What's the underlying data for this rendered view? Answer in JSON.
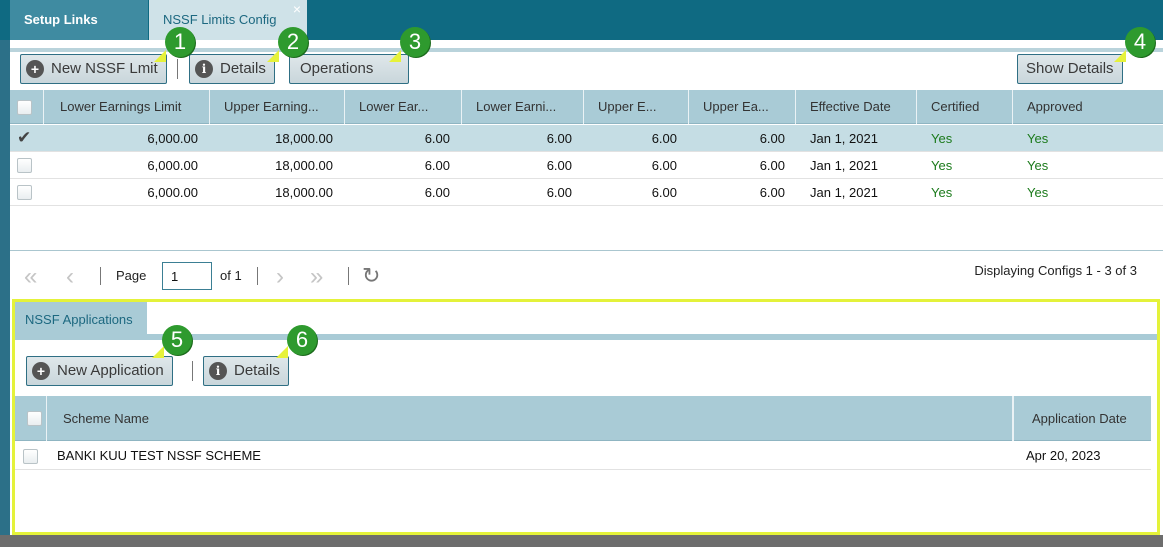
{
  "tabs": [
    {
      "label": "Setup Links"
    },
    {
      "label": "NSSF Limits Config",
      "close": "×"
    }
  ],
  "toolbar": {
    "new_label": "New NSSF Lmit",
    "details_label": "Details",
    "operations_label": "Operations",
    "show_details_label": "Show Details"
  },
  "grid": {
    "columns": [
      "Lower Earnings Limit",
      "Upper Earning...",
      "Lower Ear...",
      "Lower Earni...",
      "Upper E...",
      "Upper Ea...",
      "Effective Date",
      "Certified",
      "Approved"
    ],
    "rows": [
      {
        "selected": true,
        "cells": [
          "6,000.00",
          "18,000.00",
          "6.00",
          "6.00",
          "6.00",
          "6.00",
          "Jan 1, 2021",
          "Yes",
          "Yes"
        ]
      },
      {
        "selected": false,
        "cells": [
          "6,000.00",
          "18,000.00",
          "6.00",
          "6.00",
          "6.00",
          "6.00",
          "Jan 1, 2021",
          "Yes",
          "Yes"
        ]
      },
      {
        "selected": false,
        "cells": [
          "6,000.00",
          "18,000.00",
          "6.00",
          "6.00",
          "6.00",
          "6.00",
          "Jan 1, 2021",
          "Yes",
          "Yes"
        ]
      }
    ]
  },
  "pager": {
    "page_label": "Page",
    "page_value": "1",
    "of_label": "of 1",
    "display": "Displaying Configs 1 - 3 of 3"
  },
  "applications": {
    "tab_label": "NSSF Applications",
    "new_label": "New Application",
    "details_label": "Details",
    "columns": [
      "Scheme Name",
      "Application Date"
    ],
    "rows": [
      {
        "scheme": "BANKI KUU TEST NSSF SCHEME",
        "date": "Apr 20, 2023"
      }
    ]
  },
  "badges": [
    "1",
    "2",
    "3",
    "4",
    "5",
    "6"
  ],
  "colors": {
    "accent": "#0f6a82",
    "header": "#a9cbd6",
    "badge": "#2e9a2e",
    "highlight": "#e4f23a",
    "yes": "#1b7a1b"
  }
}
